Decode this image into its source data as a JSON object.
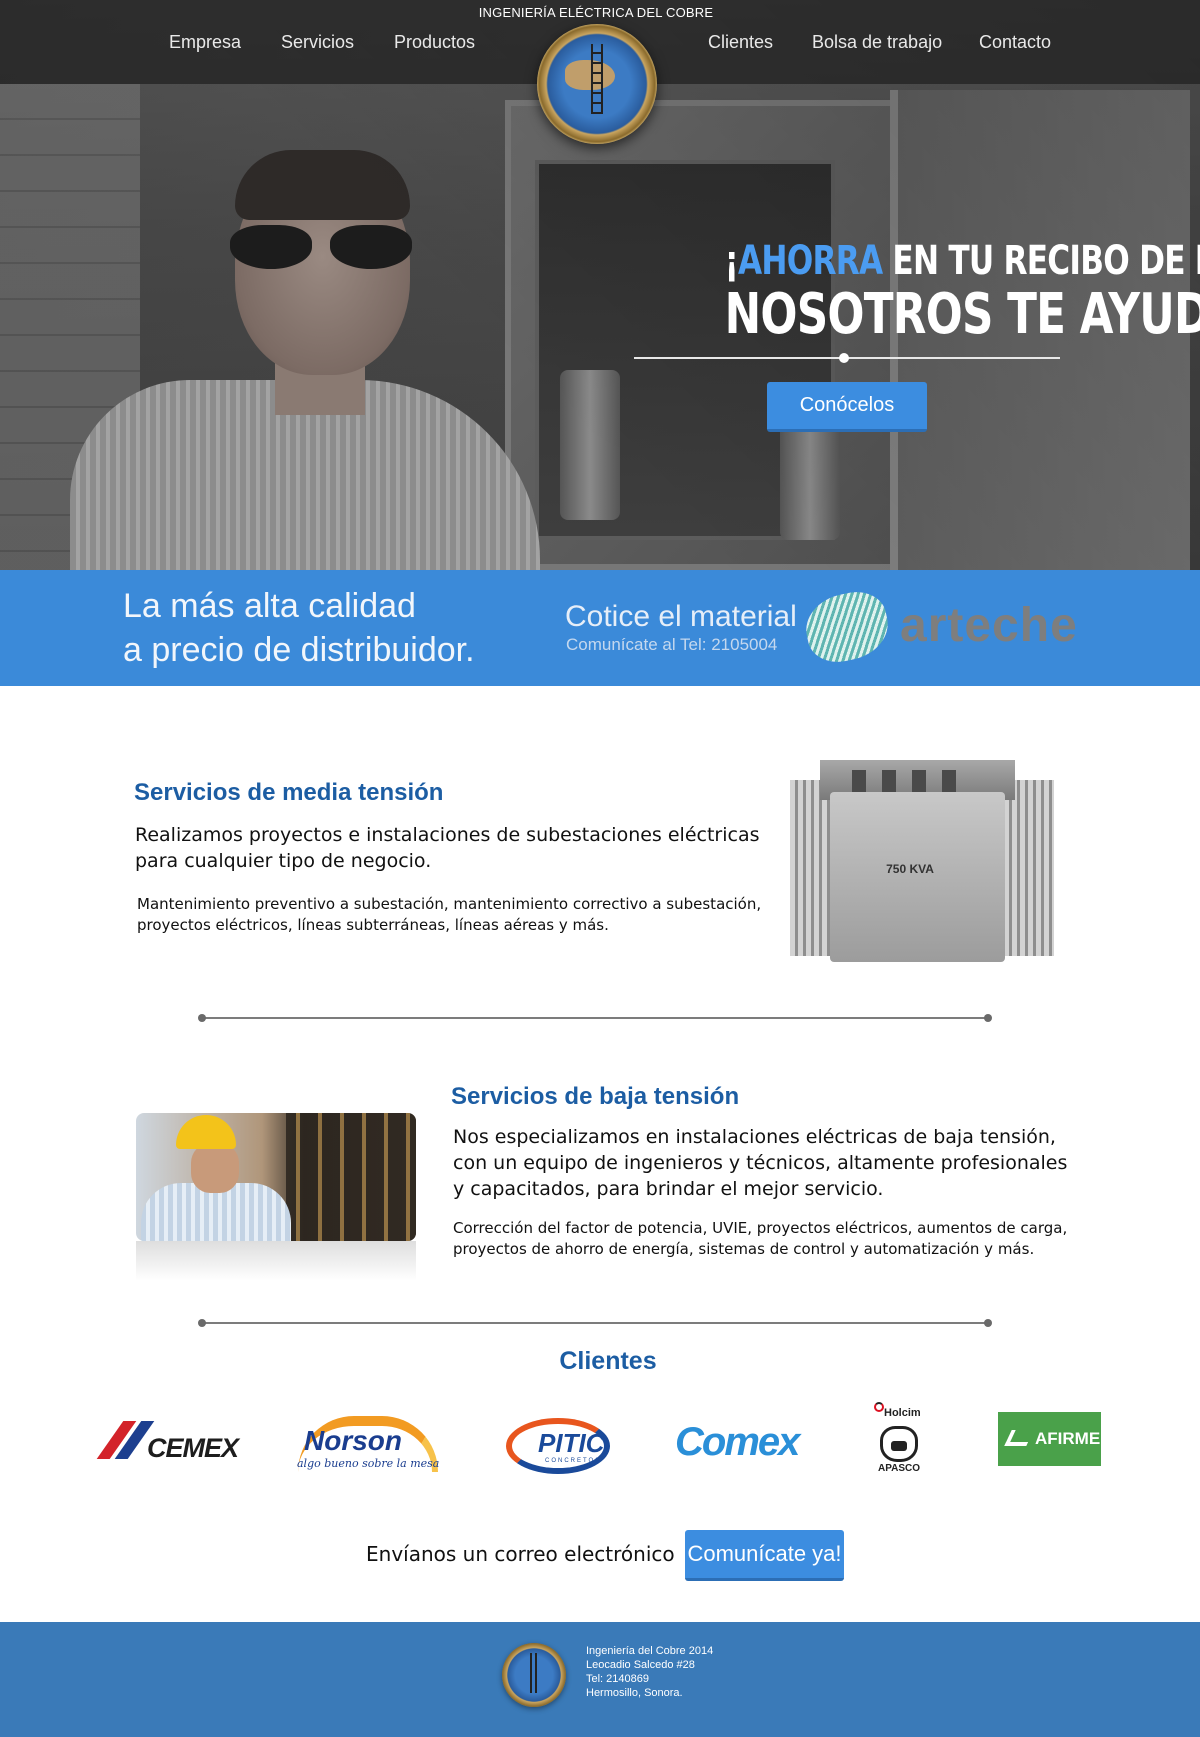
{
  "header": {
    "site_name": "INGENIERÍA ELÉCTRICA DEL COBRE",
    "nav_left": [
      "Empresa",
      "Servicios",
      "Productos"
    ],
    "nav_right": [
      "Clientes",
      "Bolsa de trabajo",
      "Contacto"
    ],
    "logo_icon": "company-seal-logo"
  },
  "hero": {
    "headline_open": "¡",
    "headline_highlight": "AHORRA",
    "headline_rest": " EN TU RECIBO DE LUZ!",
    "headline_line2": "NOSOTROS TE AYUDAMOS",
    "button_label": "Conócelos",
    "highlight_color": "#4b9cf1"
  },
  "band": {
    "quality_line1": "La más alta calidad",
    "quality_line2": "a precio de distribuidor.",
    "quote_title": "Cotice el material",
    "quote_sub": "Comunícate al Tel: 2105004",
    "partner_logo_text": "arteche",
    "background_color": "#3b8ad9"
  },
  "services": {
    "medium": {
      "title": "Servicios de media tensión",
      "lead_line1": "Realizamos proyectos e instalaciones de subestaciones eléctricas",
      "lead_line2": "para cualquier tipo de negocio.",
      "detail_line1": "Mantenimiento preventivo a subestación, mantenimiento correctivo a subestación,",
      "detail_line2": "proyectos eléctricos, líneas subterráneas, líneas aéreas y más.",
      "image_label": "750 KVA"
    },
    "low": {
      "title": "Servicios de baja tensión",
      "lead_line1": "Nos especializamos en instalaciones eléctricas de baja tensión,",
      "lead_line2": "con un equipo de ingenieros y técnicos, altamente profesionales",
      "lead_line3": "y capacitados, para brindar el mejor servicio.",
      "detail_line1": "Corrección del factor de potencia, UVIE, proyectos eléctricos, aumentos de carga,",
      "detail_line2": "proyectos de ahorro de energía, sistemas de control y automatización y más."
    }
  },
  "clients": {
    "title": "Clientes",
    "logos": {
      "cemex": "CEMEX",
      "norson": "Norson",
      "norson_tag": "algo bueno sobre la mesa",
      "pitic": "PITIC",
      "pitic_sub": "CONCRETOS",
      "comex": "Comex",
      "holcim": "Holcim",
      "apasco": "APASCO",
      "afirme": "AFIRME"
    }
  },
  "cta": {
    "text": "Envíanos un correo electrónico",
    "button_label": "Comunícate ya!"
  },
  "footer": {
    "line1": "Ingeniería del Cobre 2014",
    "line2": "Leocadio Salcedo #28",
    "line3": "Tel: 2140869",
    "line4": "Hermosillo, Sonora.",
    "background_color": "#3a7ab8"
  }
}
